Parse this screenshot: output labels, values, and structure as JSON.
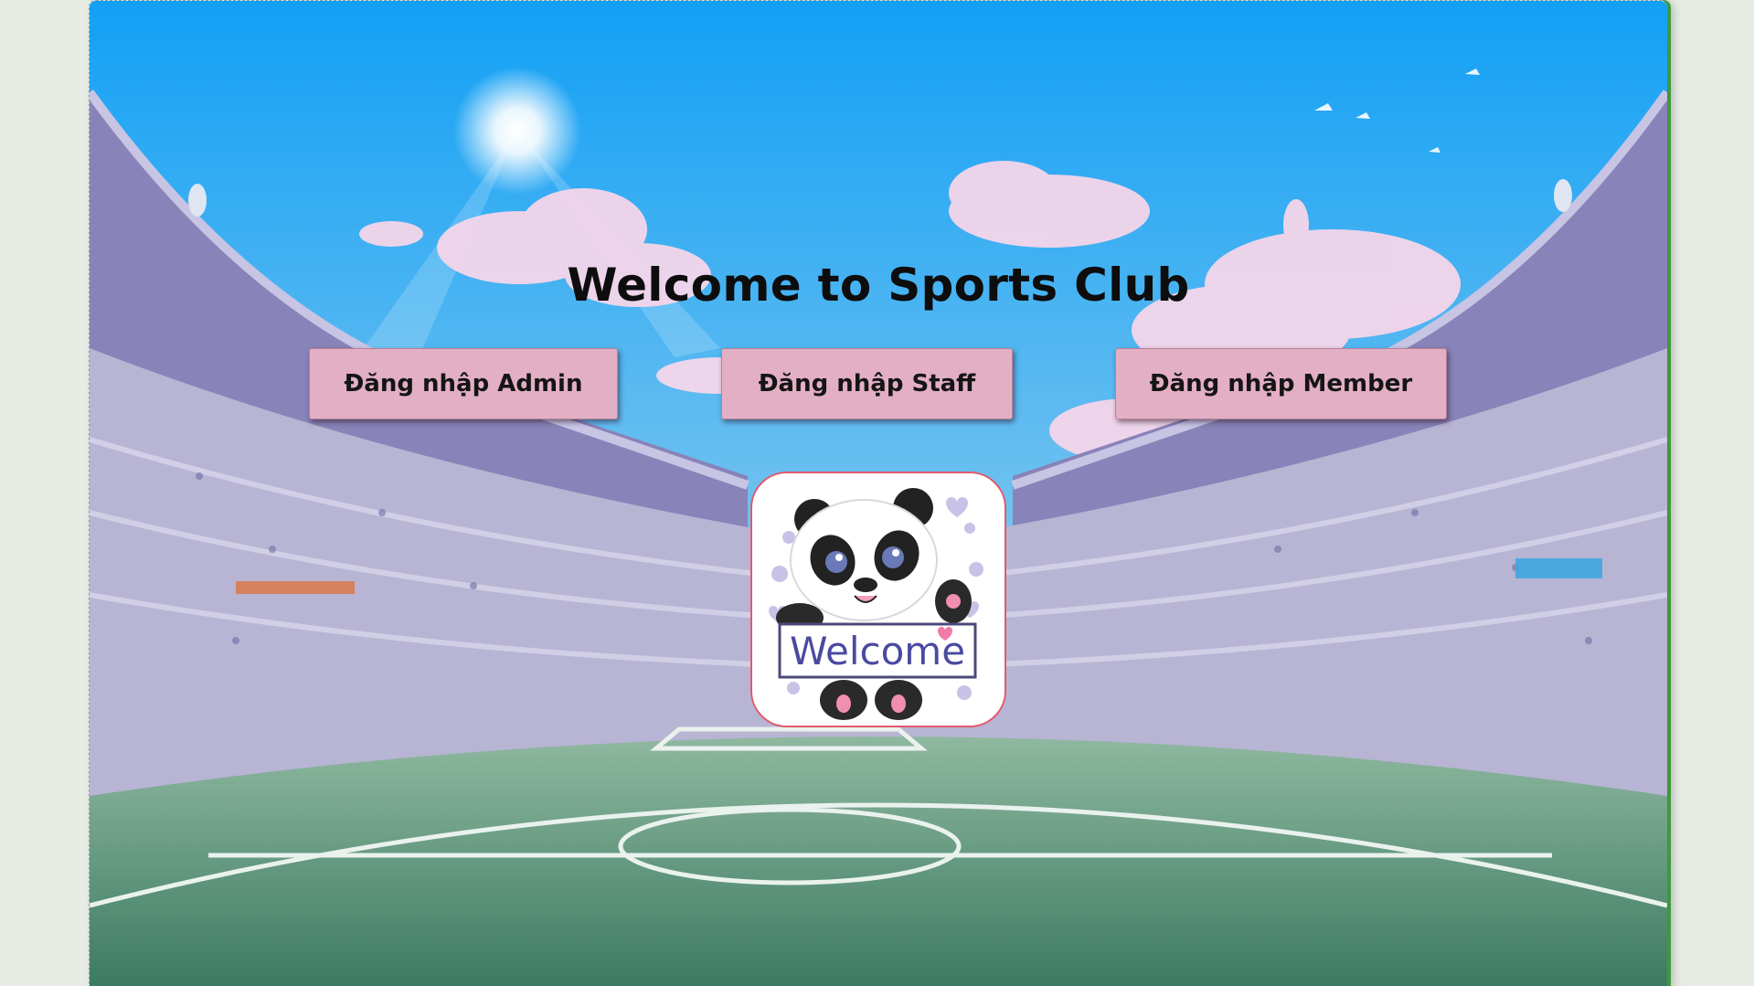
{
  "page": {
    "title": "Welcome to Sports Club"
  },
  "login_buttons": {
    "admin": "Đăng nhập Admin",
    "staff": "Đăng nhập Staff",
    "member": "Đăng nhập Member"
  },
  "logo": {
    "sign_text": "Welcome",
    "icon": "panda-welcome-icon"
  },
  "colors": {
    "button_bg": "#e3afc4",
    "sky": "#3aa6ee",
    "field": "#4c8f74",
    "stands": "#9c98c4"
  }
}
